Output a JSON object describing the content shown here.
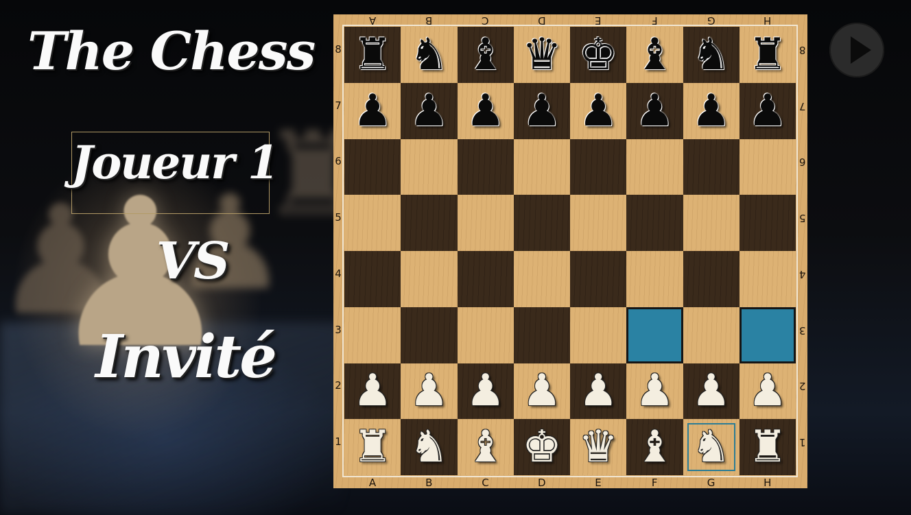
{
  "title": "The Chess",
  "players": {
    "player1": "Joueur 1",
    "vs": "VS",
    "player2": "Invité"
  },
  "play_button": {
    "icon": "play-icon"
  },
  "colors": {
    "light_square": "#ddb274",
    "dark_square": "#3a2a1b",
    "highlight": "#2a82a3",
    "frame": "#d9ac6d"
  },
  "board": {
    "files_top": [
      "A",
      "B",
      "C",
      "D",
      "E",
      "F",
      "G",
      "H"
    ],
    "files_bottom": [
      "A",
      "B",
      "C",
      "D",
      "E",
      "F",
      "G",
      "H"
    ],
    "ranks_left": [
      "8",
      "7",
      "6",
      "5",
      "4",
      "3",
      "2",
      "1"
    ],
    "ranks_right": [
      "8",
      "7",
      "6",
      "5",
      "4",
      "3",
      "2",
      "1"
    ],
    "rows": [
      [
        "b-rook",
        "b-knight",
        "b-bishop",
        "b-queen",
        "b-king",
        "b-bishop",
        "b-knight",
        "b-rook"
      ],
      [
        "b-pawn",
        "b-pawn",
        "b-pawn",
        "b-pawn",
        "b-pawn",
        "b-pawn",
        "b-pawn",
        "b-pawn"
      ],
      [
        "",
        "",
        "",
        "",
        "",
        "",
        "",
        ""
      ],
      [
        "",
        "",
        "",
        "",
        "",
        "",
        "",
        ""
      ],
      [
        "",
        "",
        "",
        "",
        "",
        "",
        "",
        ""
      ],
      [
        "",
        "",
        "",
        "",
        "",
        "",
        "",
        ""
      ],
      [
        "w-pawn",
        "w-pawn",
        "w-pawn",
        "w-pawn",
        "w-pawn",
        "w-pawn",
        "w-pawn",
        "w-pawn"
      ],
      [
        "w-rook",
        "w-knight",
        "w-bishop",
        "w-king",
        "w-queen",
        "w-bishop",
        "w-knight",
        "w-rook"
      ]
    ],
    "selected_square": "G1",
    "highlighted_squares": [
      "F3",
      "H3"
    ]
  }
}
